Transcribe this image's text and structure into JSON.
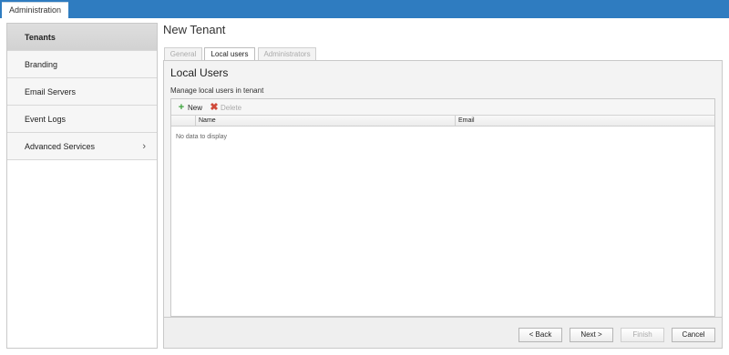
{
  "header": {
    "tab_label": "Administration"
  },
  "sidebar": {
    "items": [
      {
        "label": "Tenants"
      },
      {
        "label": "Branding"
      },
      {
        "label": "Email Servers"
      },
      {
        "label": "Event Logs"
      },
      {
        "label": "Advanced Services",
        "chevron": "›"
      }
    ]
  },
  "page": {
    "title": "New Tenant"
  },
  "tabs": [
    {
      "label": "General"
    },
    {
      "label": "Local users"
    },
    {
      "label": "Administrators"
    }
  ],
  "panel": {
    "title": "Local Users",
    "subtitle": "Manage local users in tenant",
    "toolbar": {
      "new_label": "New",
      "delete_label": "Delete",
      "new_icon": "plus-icon",
      "delete_icon": "x-icon"
    },
    "columns": [
      "Name",
      "Email"
    ],
    "empty_text": "No data to display"
  },
  "footer": {
    "back_label": "< Back",
    "next_label": "Next >",
    "finish_label": "Finish",
    "cancel_label": "Cancel"
  },
  "colors": {
    "topbar": "#2f7cc0",
    "new_icon": "#3ca33c",
    "delete_icon": "#d04a3a"
  }
}
